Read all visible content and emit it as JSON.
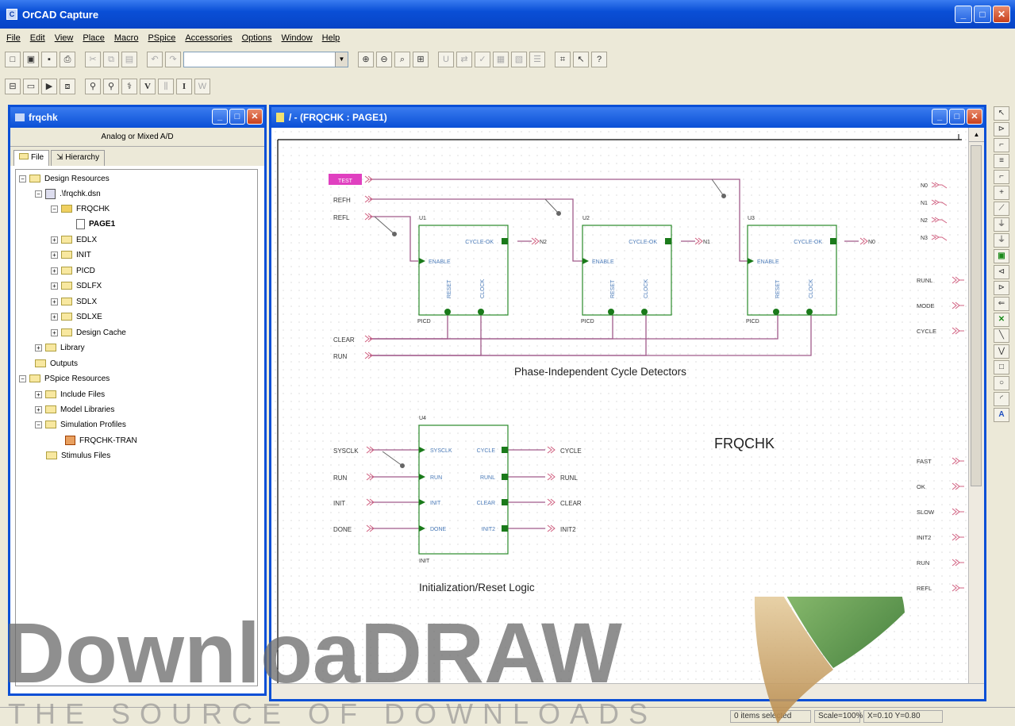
{
  "app": {
    "title": "OrCAD Capture"
  },
  "menu": [
    "File",
    "Edit",
    "View",
    "Place",
    "Macro",
    "PSpice",
    "Accessories",
    "Options",
    "Window",
    "Help"
  ],
  "project": {
    "title": "frqchk",
    "analog": "Analog or Mixed A/D",
    "tab_file": "File",
    "tab_hierarchy": "Hierarchy",
    "tree": [
      "Design Resources",
      ".\\frqchk.dsn",
      "FRQCHK",
      "PAGE1",
      "EDLX",
      "INIT",
      "PICD",
      "SDLFX",
      "SDLX",
      "SDLXE",
      "Design Cache",
      "Library",
      "Outputs",
      "PSpice Resources",
      "Include Files",
      "Model Libraries",
      "Simulation Profiles",
      "FRQCHK-TRAN",
      "Stimulus Files"
    ]
  },
  "schematic": {
    "title": "/ - (FRQCHK : PAGE1)",
    "inputs_top": [
      "TEST",
      "REFH",
      "REFL"
    ],
    "outs_right": [
      "N0",
      "N1",
      "N2",
      "N3"
    ],
    "right_ports": [
      "RUNL",
      "MODE",
      "CYCLE",
      "FAST",
      "OK",
      "SLOW",
      "INIT2",
      "RUN",
      "REFL"
    ],
    "cd_title": "Phase-Independent Cycle Detectors",
    "cd_units": [
      "U1",
      "U2",
      "U3"
    ],
    "cd_outs": [
      "N2",
      "N1",
      "N0"
    ],
    "pin_cycleok": "CYCLE-OK",
    "pin_enable": "ENABLE",
    "pin_reset": "RESET",
    "pin_clock": "CLOCK",
    "cd_type": "PICD",
    "clear": "CLEAR",
    "run": "RUN",
    "u4": "U4",
    "u4_type": "INIT",
    "u4_inputs": [
      "SYSCLK",
      "RUN",
      "INIT",
      "DONE"
    ],
    "u4_in_pins": [
      "SYSCLK",
      "RUN",
      "INIT",
      "DONE"
    ],
    "u4_out_pins": [
      "CYCLE",
      "RUNL",
      "CLEAR",
      "INIT2"
    ],
    "u4_outputs": [
      "CYCLE",
      "RUNL",
      "CLEAR",
      "INIT2"
    ],
    "init_title": "Initialization/Reset Logic",
    "page_title": "FRQCHK"
  },
  "status": {
    "sel": "0 items selected",
    "scale": "Scale=100%",
    "coords": "X=0.10  Y=0.80"
  },
  "watermark": {
    "main": "DownloaDRAW",
    "tag": "THE SOURCE OF DOWNLOADS"
  }
}
